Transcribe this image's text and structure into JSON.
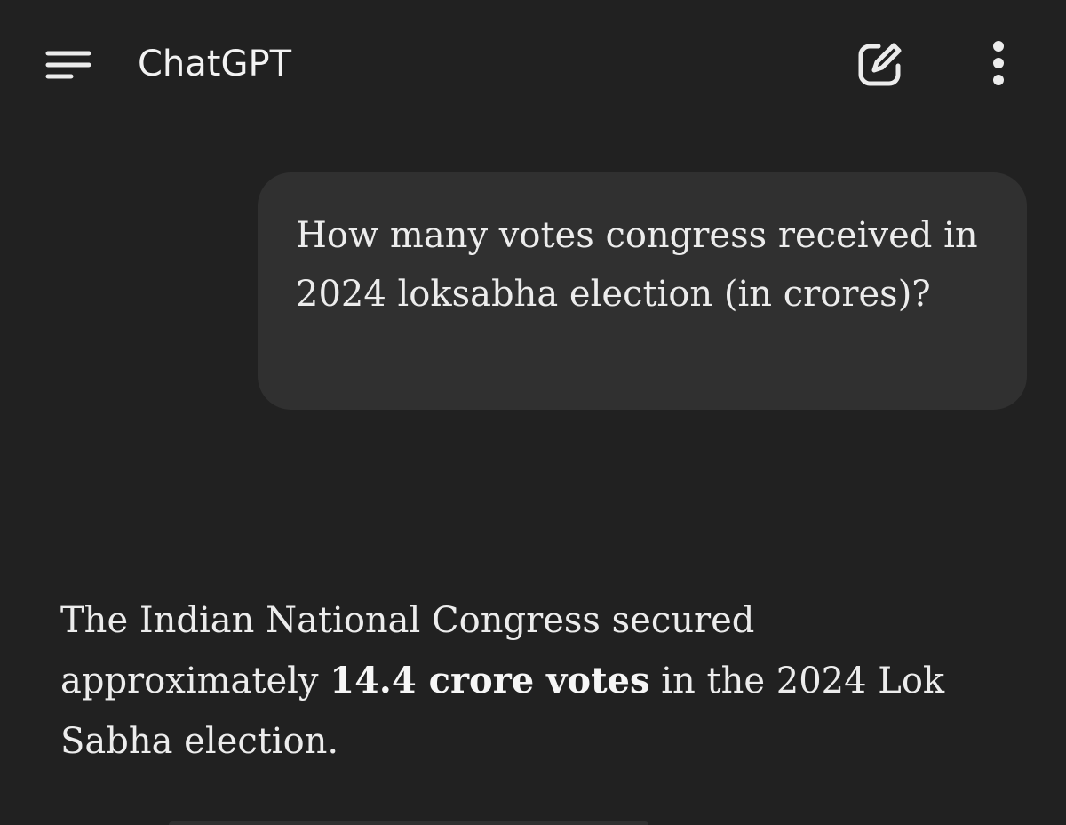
{
  "app": {
    "title": "ChatGPT",
    "icons": {
      "menu": "menu-icon",
      "new_chat": "edit-icon",
      "more": "more-vertical-icon"
    }
  },
  "conversation": {
    "user_message": "How many votes congress received in 2024 loksabha election (in crores)?",
    "assistant_message": {
      "before": "The Indian National Congress secured approximately ",
      "bold": "14.4 crore votes",
      "after": " in the 2024 Lok Sabha election."
    }
  },
  "colors": {
    "background": "#212121",
    "user_bubble": "#303030",
    "text": "#ececec"
  }
}
